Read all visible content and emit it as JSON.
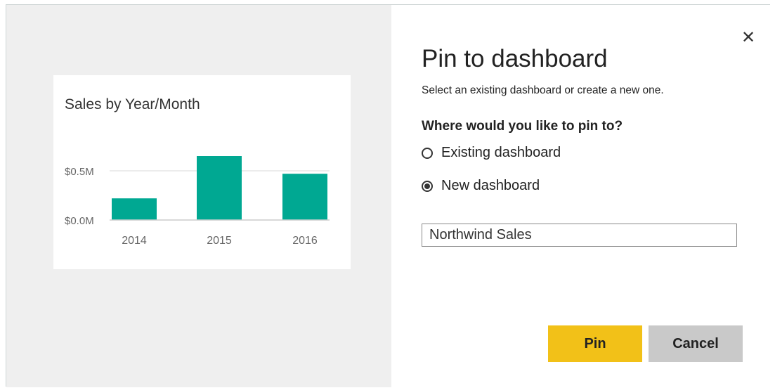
{
  "dialog": {
    "title": "Pin to dashboard",
    "subtitle": "Select an existing dashboard or create a new one.",
    "close_icon": "close-icon",
    "question": "Where would you like to pin to?",
    "options": [
      {
        "label": "Existing dashboard",
        "checked": false
      },
      {
        "label": "New dashboard",
        "checked": true
      }
    ],
    "dashboard_name_value": "Northwind Sales",
    "pin_label": "Pin",
    "cancel_label": "Cancel"
  },
  "colors": {
    "bar": "#00a892",
    "pin_button": "#f2c118",
    "cancel_button": "#c9c9c9",
    "left_pane": "#efefef"
  },
  "chart_data": {
    "type": "bar",
    "title": "Sales by Year/Month",
    "categories": [
      "2014",
      "2015",
      "2016"
    ],
    "values": [
      0.22,
      0.65,
      0.47
    ],
    "ytick_labels": [
      "$0.0M",
      "$0.5M"
    ],
    "yticks": [
      0,
      0.5
    ],
    "ylim": [
      0,
      0.7
    ],
    "grid": true
  }
}
